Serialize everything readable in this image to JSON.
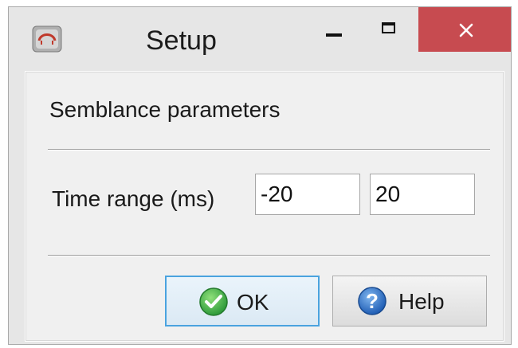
{
  "window": {
    "title": "Setup",
    "icon": "app-icon",
    "controls": [
      "minimize-icon",
      "maximize-icon",
      "close-icon"
    ]
  },
  "section": {
    "title": "Semblance parameters"
  },
  "time_range": {
    "label": "Time range (ms)",
    "min_value": "-20",
    "max_value": "20"
  },
  "buttons": {
    "ok_label": "OK",
    "ok_icon": "check-icon",
    "help_label": "Help",
    "help_icon": "question-icon"
  },
  "colors": {
    "close_button": "#c74b50",
    "ok_icon": "#3aa84a",
    "help_icon": "#2a6fc4"
  }
}
